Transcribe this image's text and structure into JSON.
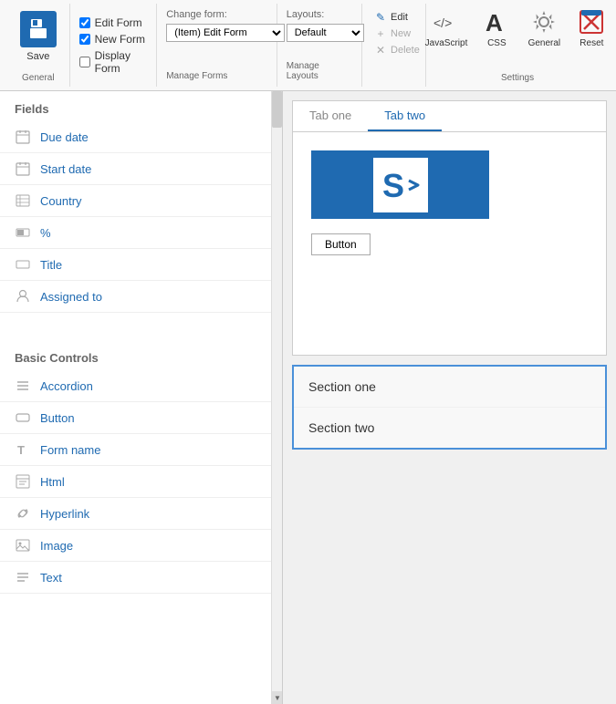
{
  "ribbon": {
    "save_label": "Save",
    "checkboxes": [
      {
        "label": "Edit Form",
        "checked": true
      },
      {
        "label": "New Form",
        "checked": true
      },
      {
        "label": "Display Form",
        "checked": false
      }
    ],
    "general_label": "General",
    "change_form_label": "Change form:",
    "change_form_value": "(Item) Edit Form",
    "manage_forms_label": "Manage Forms",
    "layouts_label": "Layouts:",
    "layouts_value": "Default",
    "manage_layouts_label": "Manage Layouts",
    "edit_btn": "Edit",
    "new_btn": "New",
    "delete_btn": "Delete",
    "settings_label": "Settings",
    "settings_items": [
      {
        "label": "JavaScript",
        "icon": "⟨/⟩"
      },
      {
        "label": "CSS",
        "icon": "A"
      },
      {
        "label": "General",
        "icon": "⚙"
      },
      {
        "label": "Reset",
        "icon": "✕"
      }
    ]
  },
  "left_panel": {
    "fields_header": "Fields",
    "fields": [
      {
        "label": "Due date",
        "icon": "▦"
      },
      {
        "label": "Start date",
        "icon": "▦"
      },
      {
        "label": "Country",
        "icon": "▤"
      },
      {
        "label": "%",
        "icon": "▭"
      },
      {
        "label": "Title",
        "icon": "▭"
      },
      {
        "label": "Assigned to",
        "icon": "👤"
      }
    ],
    "basic_controls_header": "Basic Controls",
    "controls": [
      {
        "label": "Accordion",
        "icon": "☰"
      },
      {
        "label": "Button",
        "icon": "▭"
      },
      {
        "label": "Form name",
        "icon": "T"
      },
      {
        "label": "Html",
        "icon": "📄"
      },
      {
        "label": "Hyperlink",
        "icon": "🔗"
      },
      {
        "label": "Image",
        "icon": "▦"
      },
      {
        "label": "Text",
        "icon": "☰"
      }
    ]
  },
  "form_editor": {
    "tabs": [
      {
        "label": "Tab one",
        "active": false
      },
      {
        "label": "Tab two",
        "active": true
      }
    ],
    "button_label": "Button"
  },
  "sections": [
    {
      "label": "Section one"
    },
    {
      "label": "Section two"
    }
  ]
}
